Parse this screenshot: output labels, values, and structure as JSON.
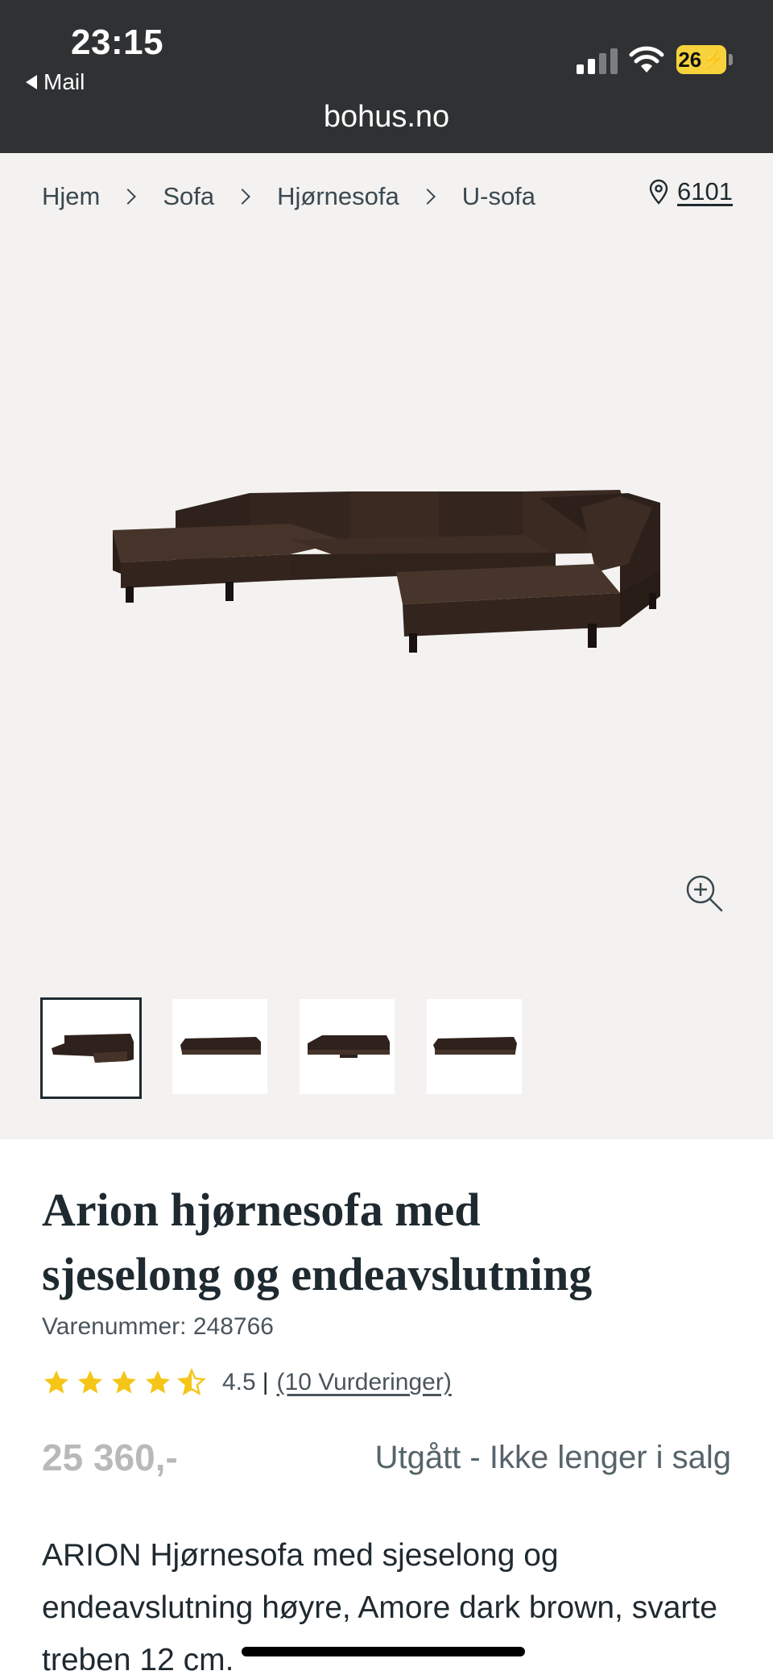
{
  "status_bar": {
    "time": "23:15",
    "back_label": "Mail",
    "battery": "26"
  },
  "browser": {
    "url": "bohus.no"
  },
  "breadcrumb": [
    {
      "label": "Hjem"
    },
    {
      "label": "Sofa"
    },
    {
      "label": "Hjørnesofa"
    },
    {
      "label": "U-sofa"
    }
  ],
  "store": {
    "icon": "location-pin-icon",
    "number": "6101"
  },
  "gallery": {
    "zoom_icon": "zoom-in-icon",
    "thumbnails": [
      {
        "name": "thumb-1",
        "active": true
      },
      {
        "name": "thumb-2",
        "active": false
      },
      {
        "name": "thumb-3",
        "active": false
      },
      {
        "name": "thumb-4",
        "active": false
      }
    ]
  },
  "product": {
    "title_line1": "Arion hjørnesofa med",
    "title_line2": "sjeselong og endeavslutning",
    "sku": "Varenummer: 248766",
    "rating_value": "4.5",
    "rating_separator": "|",
    "reviews_label": "(10 Vurderinger)",
    "stars": 4.5,
    "price": "25 360,-",
    "availability": "Utgått - Ikke lenger i salg",
    "description": "ARION Hjørnesofa med sjeselong og endeavslutning høyre, Amore dark brown, svarte treben 12 cm."
  },
  "colors": {
    "topbar": "#2f3133",
    "gallery_bg": "#f3f2f0",
    "star": "#f5c518",
    "text": "#1f2a30",
    "sofa": "#3a2a22"
  }
}
